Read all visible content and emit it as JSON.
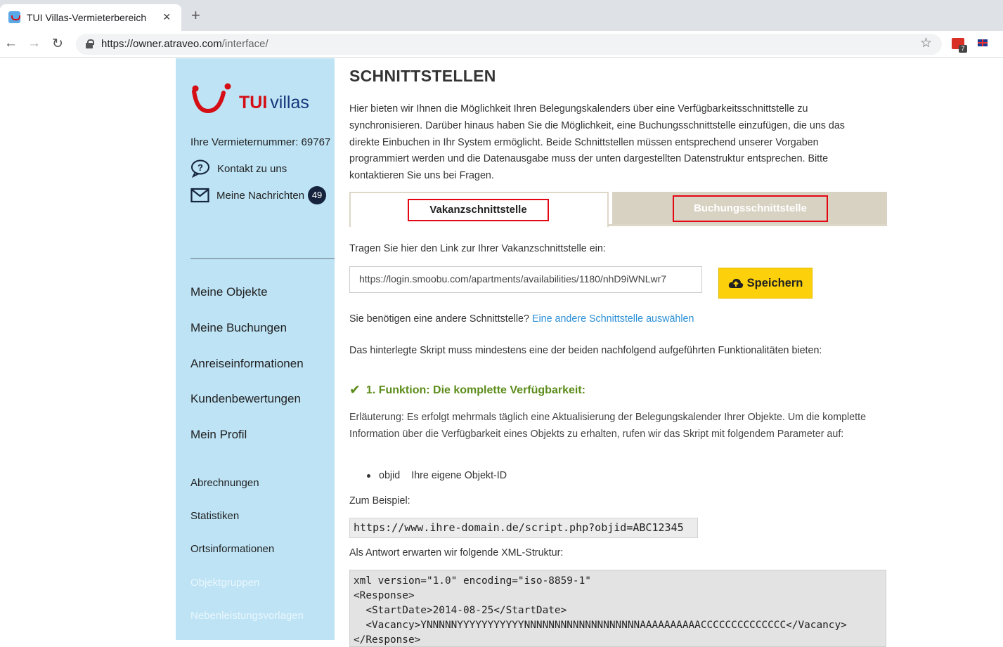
{
  "browser": {
    "tab_title": "TUI Villas-Vermieterbereich",
    "close_glyph": "×",
    "new_tab_glyph": "+",
    "url_host": "https://owner.atraveo.com",
    "url_path": "/interface/",
    "extension_badge": "7",
    "icons": [
      "back-arrow-icon",
      "forward-arrow-icon",
      "reload-icon",
      "lock-icon",
      "star-icon"
    ]
  },
  "sidebar": {
    "logo_tui": "TUI",
    "logo_villas": "villas",
    "owner_number": "Ihre Vermieternummer: 69767",
    "contact": "Kontakt zu uns",
    "messages": "Meine Nachrichten",
    "messages_count": "49",
    "menu_primary": [
      "Meine Objekte",
      "Meine Buchungen",
      "Anreiseinformationen",
      "Kundenbewertungen",
      "Mein Profil"
    ],
    "menu_secondary": [
      "Abrechnungen",
      "Statistiken",
      "Ortsinformationen"
    ],
    "menu_disabled": [
      "Objektgruppen",
      "Nebenleistungsvorlagen"
    ]
  },
  "main": {
    "title": "SCHNITTSTELLEN",
    "intro": "Hier bieten wir Ihnen die Möglichkeit Ihren Belegungskalenders über eine Verfügbarkeitsschnittstelle zu synchronisieren. Darüber hinaus haben Sie die Möglichkeit, eine Buchungsschnittstelle einzufügen, die uns das direkte Einbuchen in Ihr System ermöglicht. Beide Schnittstellen müssen entsprechend unserer Vorgaben programmiert werden und die Datenausgabe muss der unten dargestellten Datenstruktur entsprechen. Bitte kontaktieren Sie uns bei Fragen.",
    "tabs": [
      {
        "label": "Vakanzschnittstelle",
        "active": true
      },
      {
        "label": "Buchungsschnittstelle",
        "active": false
      }
    ],
    "link_label": "Tragen Sie hier den Link zur Ihrer Vakanzschnittstelle ein:",
    "link_value": "https://login.smoobu.com/apartments/availabilities/1180/nhD9iWNLwr7",
    "save_label": "Speichern",
    "other_question": "Sie benötigen eine andere Schnittstelle?",
    "other_link": "Eine andere Schnittstelle auswählen",
    "script_note": "Das hinterlegte Skript muss mindestens eine der beiden nachfolgend aufgeführten Funktionalitäten bieten:",
    "function_heading": "1. Funktion: Die komplette Verfügbarkeit:",
    "explanation": "Erläuterung: Es erfolgt mehrmals täglich eine Aktualisierung der Belegungskalender Ihrer Objekte. Um die komplette Information über die Verfügbarkeit eines Objekts zu erhalten, rufen wir das Skript mit folgendem Parameter auf:",
    "param_name": "objid",
    "param_desc": "Ihre eigene Objekt-ID",
    "example_label": "Zum Beispiel:",
    "example_url": "https://www.ihre-domain.de/script.php?objid=ABC12345",
    "answer_label": "Als Antwort erwarten wir folgende XML-Struktur:",
    "xml_lines": [
      "xml version=\"1.0\" encoding=\"iso-8859-1\"",
      "<Response>",
      "  <StartDate>2014-08-25</StartDate>",
      "  <Vacancy>YNNNNNYYYYYYYYYYYNNNNNNNNNNNNNNNNNNNAAAAAAAAAACCCCCCCCCCCCCC</Vacancy>",
      "</Response>"
    ]
  },
  "colors": {
    "sidebar_bg": "#bde3f5",
    "brand_red": "#d40e14",
    "brand_navy": "#15367a",
    "save_yellow": "#fcd00a",
    "link_blue": "#2b8fd6",
    "success_green": "#5c8c1a",
    "highlight_red": "#e30613"
  }
}
